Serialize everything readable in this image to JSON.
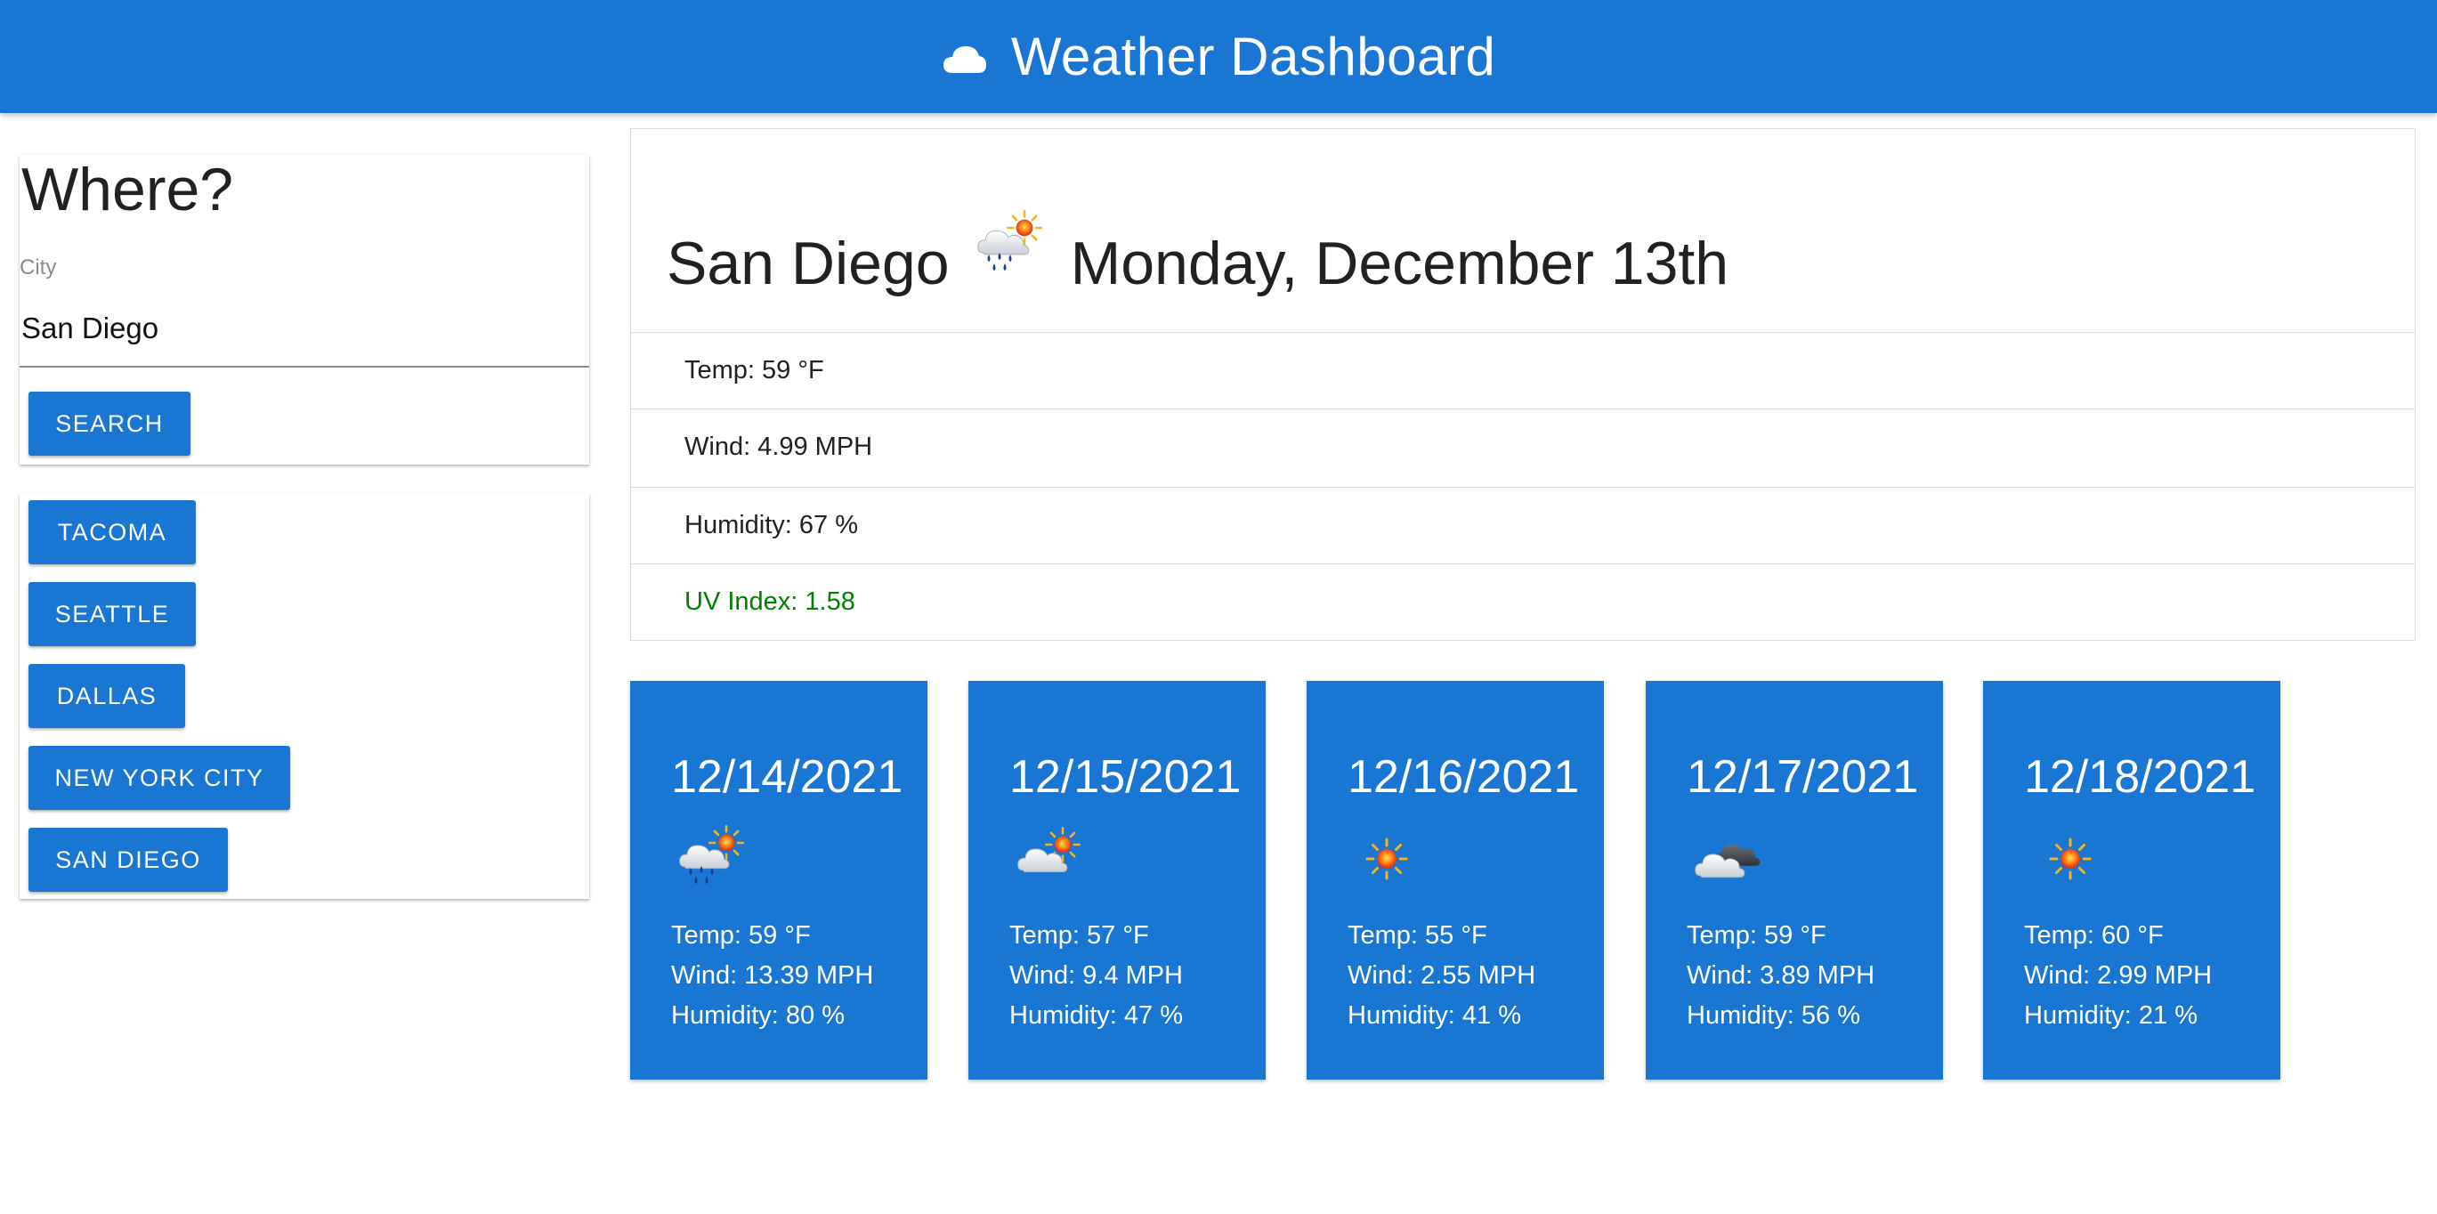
{
  "header": {
    "title": "Weather Dashboard",
    "icon": "cloud-icon"
  },
  "search": {
    "heading": "Where?",
    "city_label": "City",
    "city_value": "San Diego",
    "button_label": "SEARCH"
  },
  "history": {
    "items": [
      {
        "label": "TACOMA"
      },
      {
        "label": "SEATTLE"
      },
      {
        "label": "DALLAS"
      },
      {
        "label": "NEW YORK CITY"
      },
      {
        "label": "SAN DIEGO"
      }
    ]
  },
  "current": {
    "city": "San Diego",
    "icon": "rain-sun-icon",
    "date": "Monday, December 13th",
    "temp": "Temp: 59 °F",
    "wind": "Wind: 4.99 MPH",
    "humidity": "Humidity: 67 %",
    "uv": "UV Index: 1.58",
    "uv_color": "#008000"
  },
  "forecast": [
    {
      "date": "12/14/2021",
      "icon": "rain-sun-icon",
      "temp": "Temp: 59 °F",
      "wind": "Wind: 13.39 MPH",
      "humidity": "Humidity: 80 %"
    },
    {
      "date": "12/15/2021",
      "icon": "cloud-sun-icon",
      "temp": "Temp: 57 °F",
      "wind": "Wind: 9.4 MPH",
      "humidity": "Humidity: 47 %"
    },
    {
      "date": "12/16/2021",
      "icon": "sun-icon",
      "temp": "Temp: 55 °F",
      "wind": "Wind: 2.55 MPH",
      "humidity": "Humidity: 41 %"
    },
    {
      "date": "12/17/2021",
      "icon": "cloudy-icon",
      "temp": "Temp: 59 °F",
      "wind": "Wind: 3.89 MPH",
      "humidity": "Humidity: 56 %"
    },
    {
      "date": "12/18/2021",
      "icon": "sun-icon",
      "temp": "Temp: 60 °F",
      "wind": "Wind: 2.99 MPH",
      "humidity": "Humidity: 21 %"
    }
  ],
  "colors": {
    "primary": "#1976d2",
    "uv_good": "#008000"
  }
}
